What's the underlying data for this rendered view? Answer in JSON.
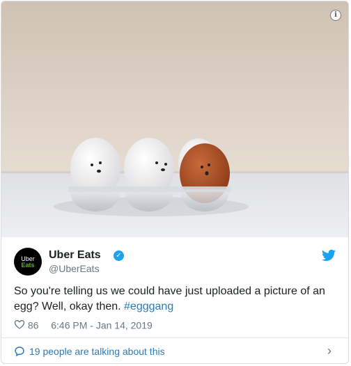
{
  "media": {
    "description_icon": "info-icon",
    "info_glyph": "i"
  },
  "author": {
    "avatar_line1": "Uber",
    "avatar_line2": "Eats",
    "name": "Uber Eats",
    "handle": "@UberEats",
    "verified_icon": "verified-badge-icon"
  },
  "tweet": {
    "text": "So you're telling us we could have just uploaded a picture of an egg? Well, okay then.",
    "hashtag": "#egggang"
  },
  "stats": {
    "likes": "86",
    "timestamp": "6:46 PM - Jan 14, 2019"
  },
  "footer": {
    "talking": "19 people are talking about this"
  },
  "colors": {
    "link": "#2b7bb9",
    "verified": "#1da1f2",
    "avatar_bg": "#000000",
    "avatar_accent": "#5fb709"
  }
}
